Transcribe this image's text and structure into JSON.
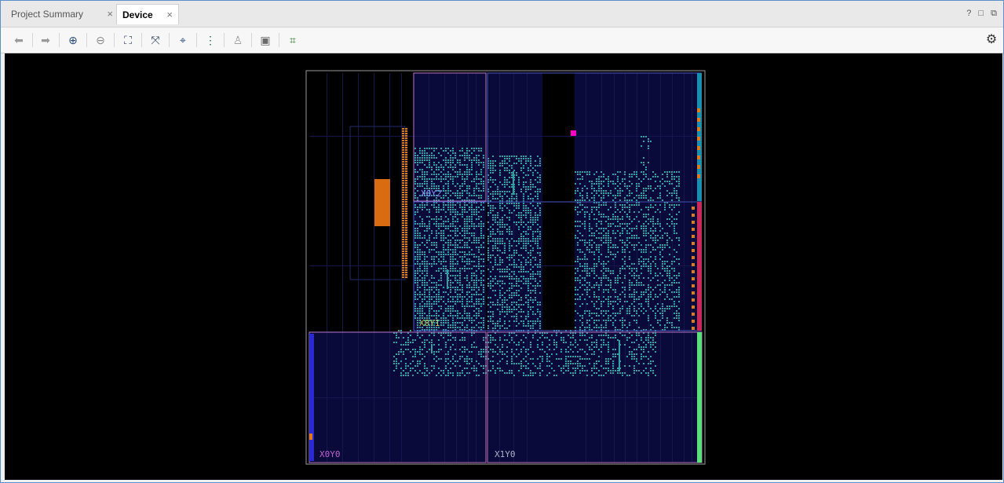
{
  "tabs": [
    {
      "label": "Project Summary",
      "close": "×",
      "active": false
    },
    {
      "label": "Device",
      "close": "×",
      "active": true
    }
  ],
  "window_controls": {
    "help": "?",
    "maximize": "□",
    "restore": "⧉"
  },
  "toolbar": {
    "icons": [
      "back-icon",
      "forward-icon",
      "zoom-in-icon",
      "zoom-out-icon",
      "zoom-fit-icon",
      "zoom-selected-icon",
      "autofit-selection-icon",
      "routing-resources-icon",
      "placement-icon",
      "cell-icon",
      "interconnect-icon"
    ],
    "glyphs": [
      "⬅",
      "➡",
      "⊕",
      "⊖",
      "⛶",
      "⤧",
      "⌖",
      "⋮",
      "♙",
      "▣",
      "⌗"
    ],
    "settings_glyph": "⚙"
  },
  "device": {
    "regions": [
      "X0Y2",
      "X0Y1",
      "X0Y0",
      "X1Y0"
    ],
    "colors": {
      "background": "#000000",
      "fabric": "#0a0a3a",
      "grid": "#16164f",
      "placed_cells": "#2fa3a3",
      "io_bank": "#e07a1a",
      "clock_region_border": "#b874c2",
      "pblock_border": "#4a56c8",
      "io_strip_blue": "#1a8fb0",
      "io_strip_green": "#5ce07a",
      "marker_magenta": "#ff00c8"
    }
  }
}
